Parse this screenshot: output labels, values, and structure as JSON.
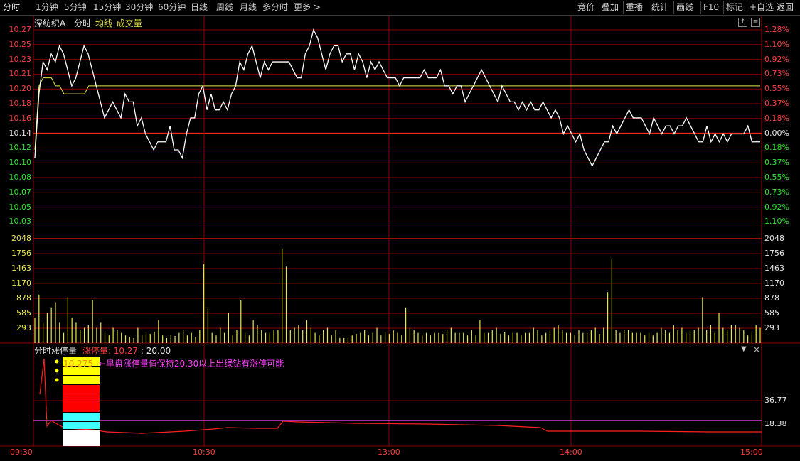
{
  "toolbar": {
    "periods": [
      "分时",
      "1分钟",
      "5分钟",
      "15分钟",
      "30分钟",
      "60分钟",
      "日线",
      "周线",
      "月线",
      "多分时",
      "更多 >"
    ],
    "actions": [
      "竞价",
      "叠加",
      "重播",
      "统计",
      "画线",
      "F10",
      "标记",
      "+自选",
      "返回"
    ]
  },
  "main_header": {
    "stock": "深纺织A",
    "mode": "分时",
    "avg_label": "均线",
    "vol_label": "成交量"
  },
  "indicator": {
    "name": "分时涨停量",
    "param_label": "涨停量",
    "param_value": ": 10.27",
    "param_value2": ": 20.00",
    "note_value": "10.275",
    "note_text": "←早盘涨停量值保持20,30以上出绿钻有涨停可能",
    "y_labels": [
      "36.77",
      "18.38"
    ]
  },
  "price_axis": {
    "left": [
      "10.27",
      "10.25",
      "10.23",
      "10.21",
      "10.20",
      "10.18",
      "10.16",
      "10.14",
      "10.12",
      "10.10",
      "10.08",
      "10.07",
      "10.05",
      "10.03"
    ],
    "right": [
      "1.28%",
      "1.10%",
      "0.92%",
      "0.73%",
      "0.55%",
      "0.37%",
      "0.18%",
      "0.00%",
      "0.18%",
      "0.37%",
      "0.55%",
      "0.73%",
      "0.92%",
      "1.10%"
    ]
  },
  "volume_axis": [
    "2048",
    "1756",
    "1463",
    "1170",
    "878",
    "585",
    "293"
  ],
  "time_axis": [
    "09:30",
    "10:30",
    "13:00",
    "14:00",
    "15:00"
  ],
  "colors": {
    "up": "#ff3c3c",
    "down": "#2ee62e",
    "grid": "#8b0000",
    "price": "#ffffff",
    "avg": "#e8e84a",
    "volume": "#e8e84a"
  },
  "chart_data": {
    "type": "line",
    "prev_close": 10.14,
    "ylim": [
      10.02,
      10.28
    ],
    "x": [
      "09:30",
      "10:30",
      "11:30/13:00",
      "14:00",
      "15:00"
    ],
    "series": [
      {
        "values": [
          10.11,
          10.19,
          10.23,
          10.22,
          10.24,
          10.23,
          10.25,
          10.24,
          10.22,
          10.2,
          10.21,
          10.23,
          10.25,
          10.24,
          10.22,
          10.2,
          10.18,
          10.16,
          10.17,
          10.18,
          10.17,
          10.16,
          10.19,
          10.18,
          10.18,
          10.15,
          10.16,
          10.14,
          10.13,
          10.12,
          10.13,
          10.13,
          10.13,
          10.15,
          10.12,
          10.12,
          10.11,
          10.14,
          10.16,
          10.16,
          10.19,
          10.2,
          10.17,
          10.19,
          10.17,
          10.17,
          10.18,
          10.17,
          10.19,
          10.2,
          10.23,
          10.22,
          10.24,
          10.25,
          10.23,
          10.21,
          10.23,
          10.22,
          10.23,
          10.23,
          10.23,
          10.23,
          10.23,
          10.22,
          10.21,
          10.21,
          10.24,
          10.25,
          10.27,
          10.26,
          10.24,
          10.22,
          10.24,
          10.25,
          10.25,
          10.23,
          10.24,
          10.24,
          10.22,
          10.24,
          10.23,
          10.21,
          10.23,
          10.22,
          10.23,
          10.22,
          10.21,
          10.21,
          10.21,
          10.2,
          10.21,
          10.21,
          10.21,
          10.21,
          10.21,
          10.22,
          10.21,
          10.21,
          10.21,
          10.22,
          10.2,
          10.2,
          10.19,
          10.2,
          10.2,
          10.18,
          10.19,
          10.2,
          10.21,
          10.22,
          10.21,
          10.2,
          10.19,
          10.18,
          10.2,
          10.19,
          10.18,
          10.18,
          10.17,
          10.18,
          10.17,
          10.18,
          10.17,
          10.17,
          10.18,
          10.17,
          10.16,
          10.17,
          10.16,
          10.14,
          10.15,
          10.14,
          10.13,
          10.14,
          10.12,
          10.11,
          10.1,
          10.11,
          10.12,
          10.13,
          10.13,
          10.15,
          10.14,
          10.15,
          10.16,
          10.17,
          10.16,
          10.16,
          10.16,
          10.15,
          10.14,
          10.16,
          10.15,
          10.14,
          10.15,
          10.15,
          10.14,
          10.15,
          10.15,
          10.16,
          10.15,
          10.14,
          10.13,
          10.13,
          10.15,
          10.13,
          10.14,
          10.13,
          10.14,
          10.13,
          10.14,
          10.14,
          10.14,
          10.14,
          10.15,
          10.13,
          10.13,
          10.13
        ]
      },
      {
        "values": [
          10.12,
          10.2,
          10.21,
          10.21,
          10.21,
          10.2,
          10.2,
          10.19,
          10.19,
          10.19,
          10.19,
          10.19,
          10.19,
          10.2,
          10.2,
          10.2,
          10.2,
          10.2,
          10.2,
          10.2,
          10.2,
          10.2,
          10.2,
          10.2,
          10.2,
          10.2,
          10.2,
          10.2,
          10.2,
          10.2,
          10.2,
          10.2,
          10.2,
          10.2,
          10.2,
          10.2,
          10.2,
          10.2,
          10.2,
          10.2,
          10.2,
          10.2,
          10.2,
          10.2,
          10.2,
          10.2,
          10.2,
          10.2,
          10.2,
          10.2,
          10.2,
          10.2,
          10.2,
          10.2,
          10.2,
          10.2,
          10.2,
          10.2,
          10.2,
          10.2,
          10.2,
          10.2,
          10.2,
          10.2,
          10.2,
          10.2,
          10.2,
          10.2,
          10.2,
          10.2,
          10.2,
          10.2,
          10.2,
          10.2,
          10.2,
          10.2,
          10.2,
          10.2,
          10.2,
          10.2,
          10.2,
          10.2,
          10.2,
          10.2,
          10.2,
          10.2,
          10.2,
          10.2,
          10.2,
          10.2,
          10.2,
          10.2,
          10.2,
          10.2,
          10.2,
          10.2,
          10.2,
          10.2,
          10.2,
          10.2,
          10.2,
          10.2,
          10.2,
          10.2,
          10.2,
          10.2,
          10.2,
          10.2,
          10.2,
          10.2,
          10.2,
          10.2,
          10.2,
          10.2,
          10.2,
          10.2,
          10.2,
          10.2,
          10.2,
          10.2,
          10.2,
          10.2,
          10.2,
          10.2,
          10.2,
          10.2,
          10.2,
          10.2,
          10.2,
          10.2,
          10.2,
          10.2,
          10.2,
          10.2,
          10.2,
          10.2,
          10.2,
          10.2,
          10.2,
          10.2,
          10.2,
          10.2,
          10.2,
          10.2,
          10.2,
          10.2,
          10.2,
          10.2,
          10.2,
          10.2,
          10.2,
          10.2,
          10.2,
          10.2,
          10.2,
          10.2,
          10.2,
          10.2,
          10.2,
          10.2,
          10.2,
          10.2,
          10.2,
          10.2,
          10.2,
          10.2,
          10.2,
          10.2,
          10.2,
          10.2,
          10.2,
          10.2,
          10.2,
          10.2,
          10.2,
          10.2
        ]
      }
    ],
    "volume": [
      500,
      950,
      400,
      600,
      700,
      800,
      400,
      200,
      900,
      500,
      400,
      250,
      300,
      350,
      850,
      300,
      400,
      200,
      150,
      300,
      250,
      200,
      150,
      120,
      100,
      300,
      150,
      200,
      180,
      220,
      450,
      150,
      100,
      150,
      140,
      200,
      250,
      150,
      200,
      120,
      250,
      1550,
      700,
      200,
      150,
      300,
      200,
      600,
      150,
      250,
      850,
      200,
      150,
      450,
      350,
      250,
      200,
      200,
      250,
      250,
      1850,
      1500,
      250,
      300,
      350,
      250,
      450,
      300,
      200,
      150,
      250,
      300,
      150,
      250,
      100,
      100,
      100,
      150,
      180,
      200,
      250,
      150,
      200,
      300,
      150,
      200,
      180,
      250,
      200,
      150,
      700,
      300,
      250,
      200,
      150,
      200,
      150,
      200,
      200,
      180,
      250,
      300,
      200,
      200,
      200,
      150,
      250,
      150,
      450,
      200,
      200,
      250,
      300,
      180,
      220,
      150,
      200,
      200,
      150,
      200,
      200,
      300,
      250,
      150,
      200,
      250,
      300,
      350,
      250,
      200,
      200,
      150,
      250,
      200,
      200,
      250,
      300,
      180,
      300,
      1000,
      1650,
      250,
      200,
      250,
      250,
      200,
      200,
      200,
      150,
      200,
      150,
      200,
      300,
      250,
      200,
      350,
      250,
      300,
      200,
      250,
      250,
      300,
      900,
      250,
      350,
      200,
      600,
      300,
      250,
      350,
      350,
      300,
      250,
      150,
      200,
      350,
      300
    ]
  }
}
